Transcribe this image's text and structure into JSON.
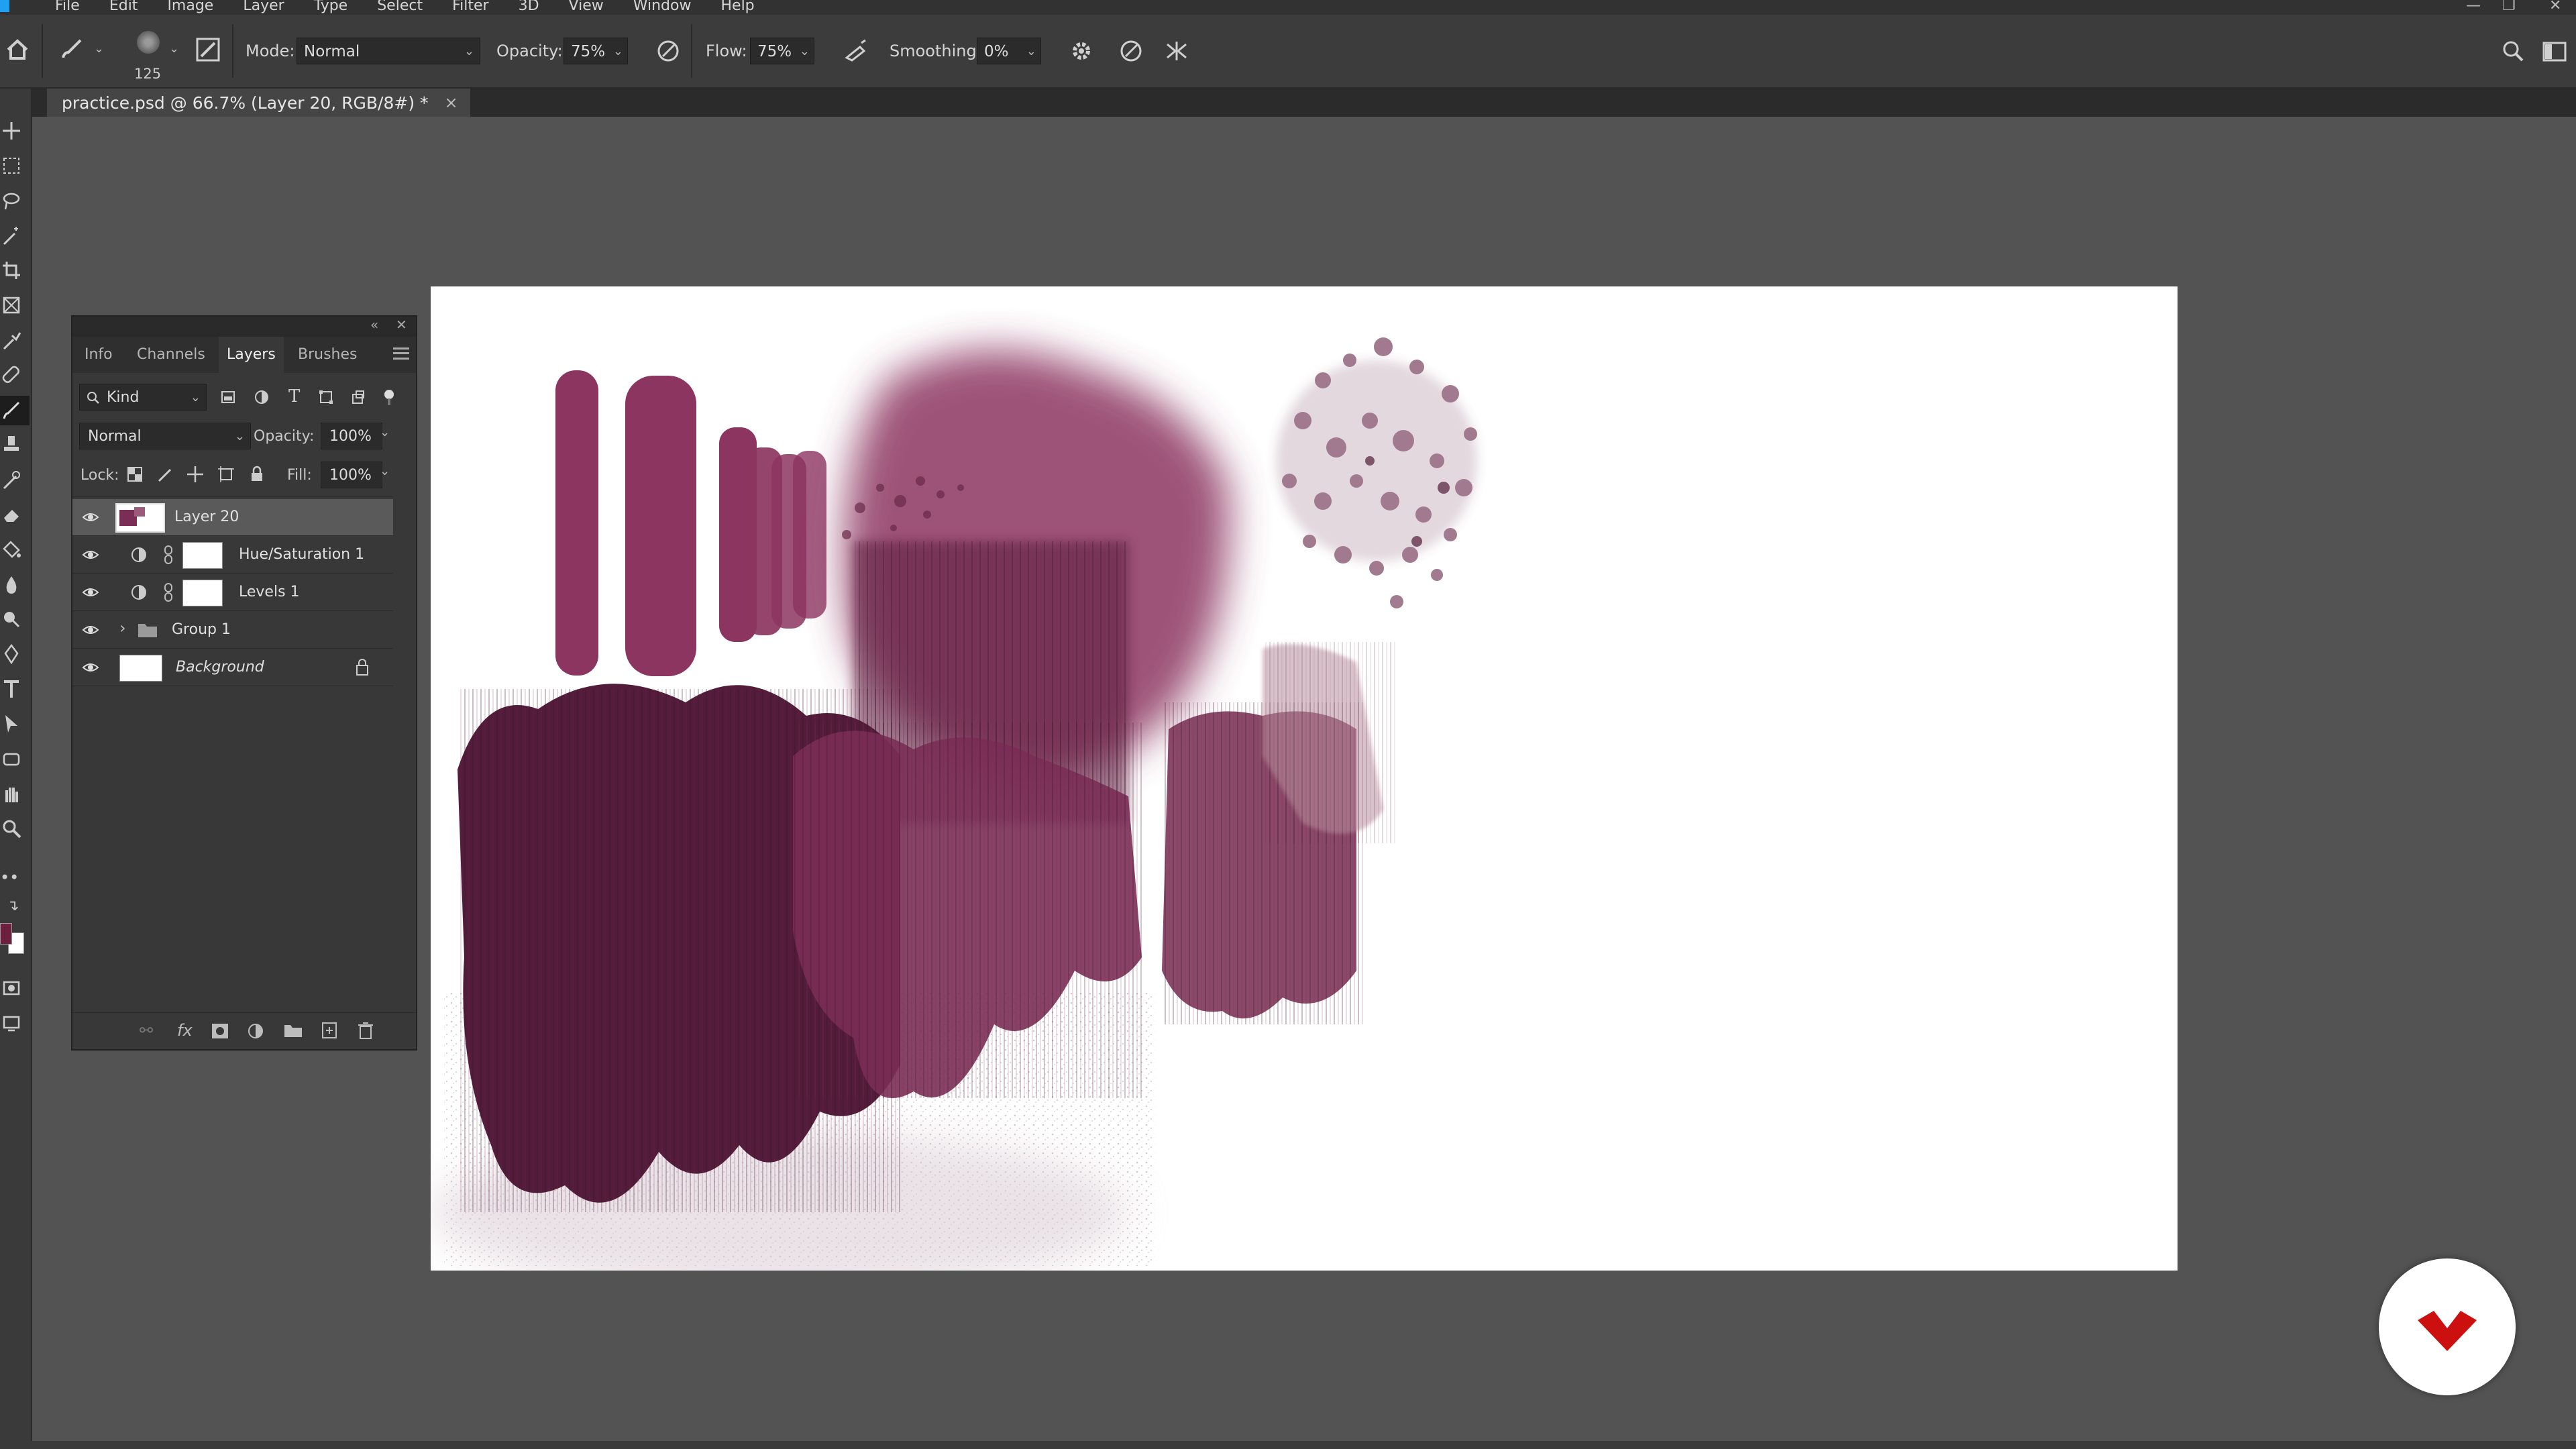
{
  "menu": [
    "File",
    "Edit",
    "Image",
    "Layer",
    "Type",
    "Select",
    "Filter",
    "3D",
    "View",
    "Window",
    "Help"
  ],
  "options": {
    "brush_size": "125",
    "mode_label": "Mode:",
    "mode_value": "Normal",
    "opacity_label": "Opacity:",
    "opacity_value": "75%",
    "flow_label": "Flow:",
    "flow_value": "75%",
    "smoothing_label": "Smoothing:",
    "smoothing_value": "0%"
  },
  "document_tab": {
    "title": "practice.psd @ 66.7% (Layer 20, RGB/8#) *",
    "close": "×"
  },
  "layers_panel": {
    "tabs": [
      "Info",
      "Channels",
      "Layers",
      "Brushes"
    ],
    "active_tab": "Layers",
    "filter_label": "Kind",
    "blend_mode": "Normal",
    "opacity_label": "Opacity:",
    "opacity_value": "100%",
    "lock_label": "Lock:",
    "fill_label": "Fill:",
    "fill_value": "100%",
    "layers": [
      {
        "name": "Layer 20",
        "selected": true
      },
      {
        "name": "Hue/Saturation 1"
      },
      {
        "name": "Levels 1"
      },
      {
        "name": "Group 1"
      },
      {
        "name": "Background",
        "locked": true
      }
    ]
  },
  "colors": {
    "foreground": "#6e1e3e",
    "background": "#ffffff",
    "paint_light": "#8c3560",
    "paint_dark": "#521c3a",
    "logo_red": "#cc1010"
  }
}
